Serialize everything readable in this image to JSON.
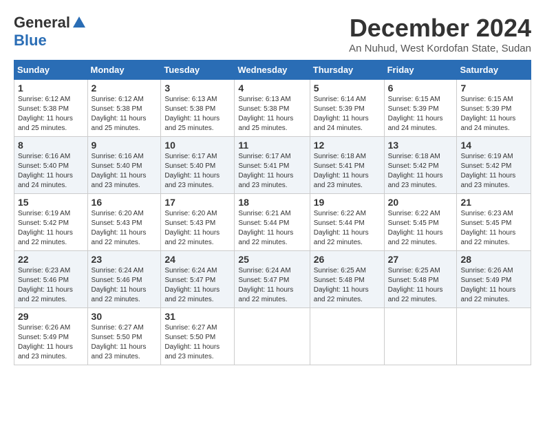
{
  "header": {
    "logo_general": "General",
    "logo_blue": "Blue",
    "month_title": "December 2024",
    "subtitle": "An Nuhud, West Kordofan State, Sudan"
  },
  "days_of_week": [
    "Sunday",
    "Monday",
    "Tuesday",
    "Wednesday",
    "Thursday",
    "Friday",
    "Saturday"
  ],
  "weeks": [
    [
      {
        "day": "1",
        "info": "Sunrise: 6:12 AM\nSunset: 5:38 PM\nDaylight: 11 hours\nand 25 minutes."
      },
      {
        "day": "2",
        "info": "Sunrise: 6:12 AM\nSunset: 5:38 PM\nDaylight: 11 hours\nand 25 minutes."
      },
      {
        "day": "3",
        "info": "Sunrise: 6:13 AM\nSunset: 5:38 PM\nDaylight: 11 hours\nand 25 minutes."
      },
      {
        "day": "4",
        "info": "Sunrise: 6:13 AM\nSunset: 5:38 PM\nDaylight: 11 hours\nand 25 minutes."
      },
      {
        "day": "5",
        "info": "Sunrise: 6:14 AM\nSunset: 5:39 PM\nDaylight: 11 hours\nand 24 minutes."
      },
      {
        "day": "6",
        "info": "Sunrise: 6:15 AM\nSunset: 5:39 PM\nDaylight: 11 hours\nand 24 minutes."
      },
      {
        "day": "7",
        "info": "Sunrise: 6:15 AM\nSunset: 5:39 PM\nDaylight: 11 hours\nand 24 minutes."
      }
    ],
    [
      {
        "day": "8",
        "info": "Sunrise: 6:16 AM\nSunset: 5:40 PM\nDaylight: 11 hours\nand 24 minutes."
      },
      {
        "day": "9",
        "info": "Sunrise: 6:16 AM\nSunset: 5:40 PM\nDaylight: 11 hours\nand 23 minutes."
      },
      {
        "day": "10",
        "info": "Sunrise: 6:17 AM\nSunset: 5:40 PM\nDaylight: 11 hours\nand 23 minutes."
      },
      {
        "day": "11",
        "info": "Sunrise: 6:17 AM\nSunset: 5:41 PM\nDaylight: 11 hours\nand 23 minutes."
      },
      {
        "day": "12",
        "info": "Sunrise: 6:18 AM\nSunset: 5:41 PM\nDaylight: 11 hours\nand 23 minutes."
      },
      {
        "day": "13",
        "info": "Sunrise: 6:18 AM\nSunset: 5:42 PM\nDaylight: 11 hours\nand 23 minutes."
      },
      {
        "day": "14",
        "info": "Sunrise: 6:19 AM\nSunset: 5:42 PM\nDaylight: 11 hours\nand 23 minutes."
      }
    ],
    [
      {
        "day": "15",
        "info": "Sunrise: 6:19 AM\nSunset: 5:42 PM\nDaylight: 11 hours\nand 22 minutes."
      },
      {
        "day": "16",
        "info": "Sunrise: 6:20 AM\nSunset: 5:43 PM\nDaylight: 11 hours\nand 22 minutes."
      },
      {
        "day": "17",
        "info": "Sunrise: 6:20 AM\nSunset: 5:43 PM\nDaylight: 11 hours\nand 22 minutes."
      },
      {
        "day": "18",
        "info": "Sunrise: 6:21 AM\nSunset: 5:44 PM\nDaylight: 11 hours\nand 22 minutes."
      },
      {
        "day": "19",
        "info": "Sunrise: 6:22 AM\nSunset: 5:44 PM\nDaylight: 11 hours\nand 22 minutes."
      },
      {
        "day": "20",
        "info": "Sunrise: 6:22 AM\nSunset: 5:45 PM\nDaylight: 11 hours\nand 22 minutes."
      },
      {
        "day": "21",
        "info": "Sunrise: 6:23 AM\nSunset: 5:45 PM\nDaylight: 11 hours\nand 22 minutes."
      }
    ],
    [
      {
        "day": "22",
        "info": "Sunrise: 6:23 AM\nSunset: 5:46 PM\nDaylight: 11 hours\nand 22 minutes."
      },
      {
        "day": "23",
        "info": "Sunrise: 6:24 AM\nSunset: 5:46 PM\nDaylight: 11 hours\nand 22 minutes."
      },
      {
        "day": "24",
        "info": "Sunrise: 6:24 AM\nSunset: 5:47 PM\nDaylight: 11 hours\nand 22 minutes."
      },
      {
        "day": "25",
        "info": "Sunrise: 6:24 AM\nSunset: 5:47 PM\nDaylight: 11 hours\nand 22 minutes."
      },
      {
        "day": "26",
        "info": "Sunrise: 6:25 AM\nSunset: 5:48 PM\nDaylight: 11 hours\nand 22 minutes."
      },
      {
        "day": "27",
        "info": "Sunrise: 6:25 AM\nSunset: 5:48 PM\nDaylight: 11 hours\nand 22 minutes."
      },
      {
        "day": "28",
        "info": "Sunrise: 6:26 AM\nSunset: 5:49 PM\nDaylight: 11 hours\nand 22 minutes."
      }
    ],
    [
      {
        "day": "29",
        "info": "Sunrise: 6:26 AM\nSunset: 5:49 PM\nDaylight: 11 hours\nand 23 minutes."
      },
      {
        "day": "30",
        "info": "Sunrise: 6:27 AM\nSunset: 5:50 PM\nDaylight: 11 hours\nand 23 minutes."
      },
      {
        "day": "31",
        "info": "Sunrise: 6:27 AM\nSunset: 5:50 PM\nDaylight: 11 hours\nand 23 minutes."
      },
      null,
      null,
      null,
      null
    ]
  ]
}
